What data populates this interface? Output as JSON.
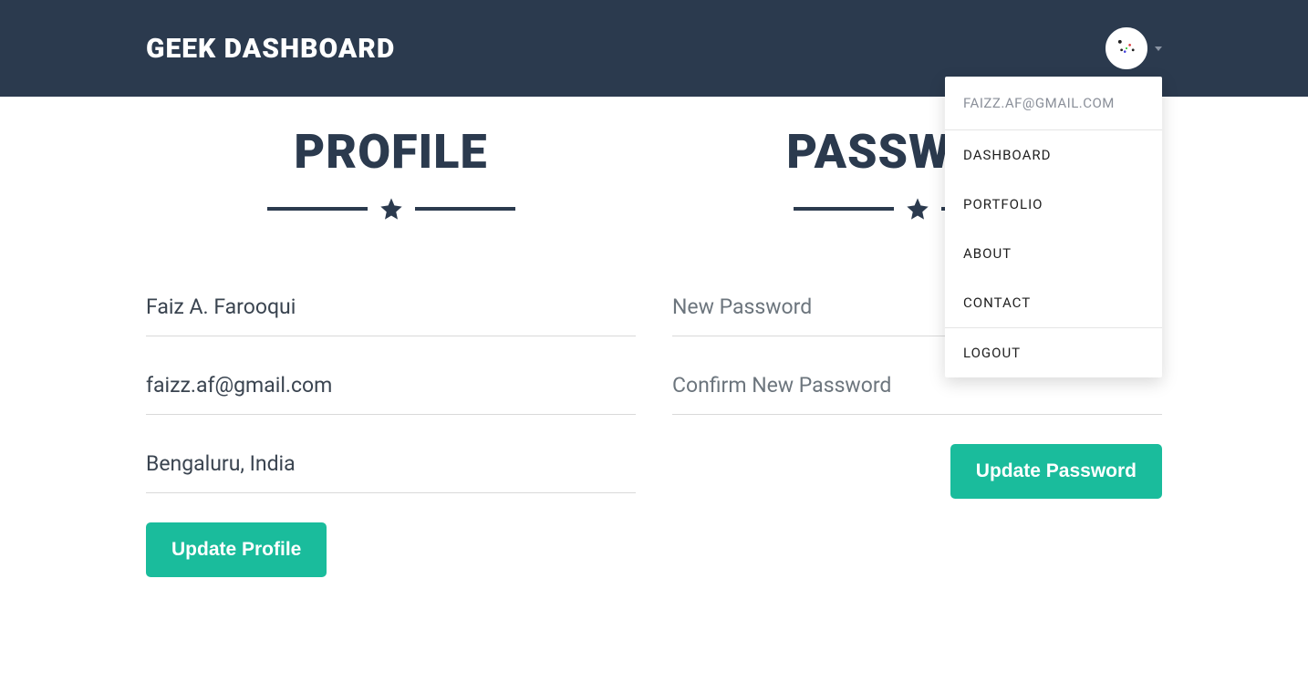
{
  "header": {
    "brand": "GEEK DASHBOARD"
  },
  "dropdown": {
    "email": "FAIZZ.AF@GMAIL.COM",
    "items": {
      "dashboard": "DASHBOARD",
      "portfolio": "PORTFOLIO",
      "about": "ABOUT",
      "contact": "CONTACT",
      "logout": "LOGOUT"
    }
  },
  "profile": {
    "title": "PROFILE",
    "name_value": "Faiz A. Farooqui",
    "email_value": "faizz.af@gmail.com",
    "location_value": "Bengaluru, India",
    "button_label": "Update Profile"
  },
  "password": {
    "title": "PASSWORD",
    "new_placeholder": "New Password",
    "confirm_placeholder": "Confirm New Password",
    "button_label": "Update Password"
  }
}
